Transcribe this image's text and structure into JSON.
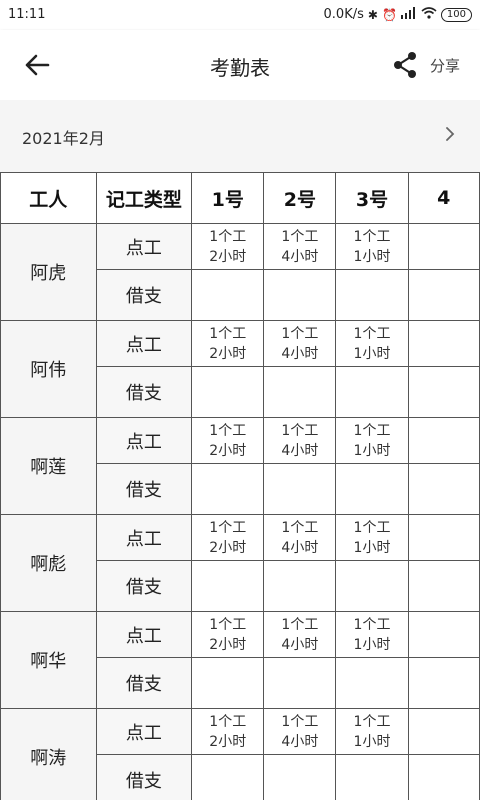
{
  "status_bar": {
    "time": "11:11",
    "network_speed": "0.0K/s",
    "battery": "100",
    "icons": [
      "bluetooth-icon",
      "alarm-icon",
      "signal-icon",
      "wifi-icon",
      "battery-icon"
    ]
  },
  "app_bar": {
    "title": "考勤表",
    "share_label": "分享",
    "icons": [
      "back-arrow-icon",
      "share-icon"
    ]
  },
  "month": {
    "label": "2021年2月",
    "next_icon": "chevron-right-icon"
  },
  "table": {
    "headers": [
      "工人",
      "记工类型",
      "1号",
      "2号",
      "3号",
      "4"
    ],
    "type_labels": {
      "work": "点工",
      "borrow": "借支"
    },
    "workers": [
      {
        "name": "阿虎",
        "work_cells": [
          {
            "line1": "1个工",
            "line2": "2小时"
          },
          {
            "line1": "1个工",
            "line2": "4小时"
          },
          {
            "line1": "1个工",
            "line2": "1小时"
          }
        ]
      },
      {
        "name": "阿伟",
        "work_cells": [
          {
            "line1": "1个工",
            "line2": "2小时"
          },
          {
            "line1": "1个工",
            "line2": "4小时"
          },
          {
            "line1": "1个工",
            "line2": "1小时"
          }
        ]
      },
      {
        "name": "啊莲",
        "work_cells": [
          {
            "line1": "1个工",
            "line2": "2小时"
          },
          {
            "line1": "1个工",
            "line2": "4小时"
          },
          {
            "line1": "1个工",
            "line2": "1小时"
          }
        ]
      },
      {
        "name": "啊彪",
        "work_cells": [
          {
            "line1": "1个工",
            "line2": "2小时"
          },
          {
            "line1": "1个工",
            "line2": "4小时"
          },
          {
            "line1": "1个工",
            "line2": "1小时"
          }
        ]
      },
      {
        "name": "啊华",
        "work_cells": [
          {
            "line1": "1个工",
            "line2": "2小时"
          },
          {
            "line1": "1个工",
            "line2": "4小时"
          },
          {
            "line1": "1个工",
            "line2": "1小时"
          }
        ]
      },
      {
        "name": "啊涛",
        "work_cells": [
          {
            "line1": "1个工",
            "line2": "2小时"
          },
          {
            "line1": "1个工",
            "line2": "4小时"
          },
          {
            "line1": "1个工",
            "line2": "1小时"
          }
        ]
      }
    ]
  }
}
